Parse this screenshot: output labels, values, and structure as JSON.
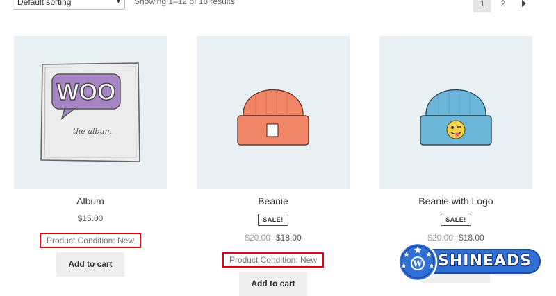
{
  "toolbar": {
    "sort_value": "Default sorting",
    "result_count": "Showing 1–12 of 18 results",
    "pages": [
      "1",
      "2"
    ],
    "current_page": "1"
  },
  "products": [
    {
      "title": "Album",
      "price": "$15.00",
      "old_price": "",
      "sale_badge": "",
      "condition": "Product Condition: New",
      "button": "Add to cart"
    },
    {
      "title": "Beanie",
      "price": "$18.00",
      "old_price": "$20.00",
      "sale_badge": "SALE!",
      "condition": "Product Condition: New",
      "button": "Add to cart"
    },
    {
      "title": "Beanie with Logo",
      "price": "$18.00",
      "old_price": "$20.00",
      "sale_badge": "SALE!",
      "condition": "",
      "button": "Add to cart"
    }
  ],
  "images": {
    "album_logo_text": "WOO",
    "album_caption": "the album"
  },
  "watermark": {
    "text": "SHINEADS"
  },
  "colors": {
    "highlight_red": "#e0001a",
    "image_bg": "#e9f0f3",
    "beanie_orange": "#f08466",
    "beanie_blue": "#6cb7d9",
    "woo_purple": "#a784c4",
    "watermark_blue": "#2f6fd6"
  },
  "icons": {
    "sort_chevron": "chevron-down-icon",
    "next_page": "triangle-right-icon"
  }
}
